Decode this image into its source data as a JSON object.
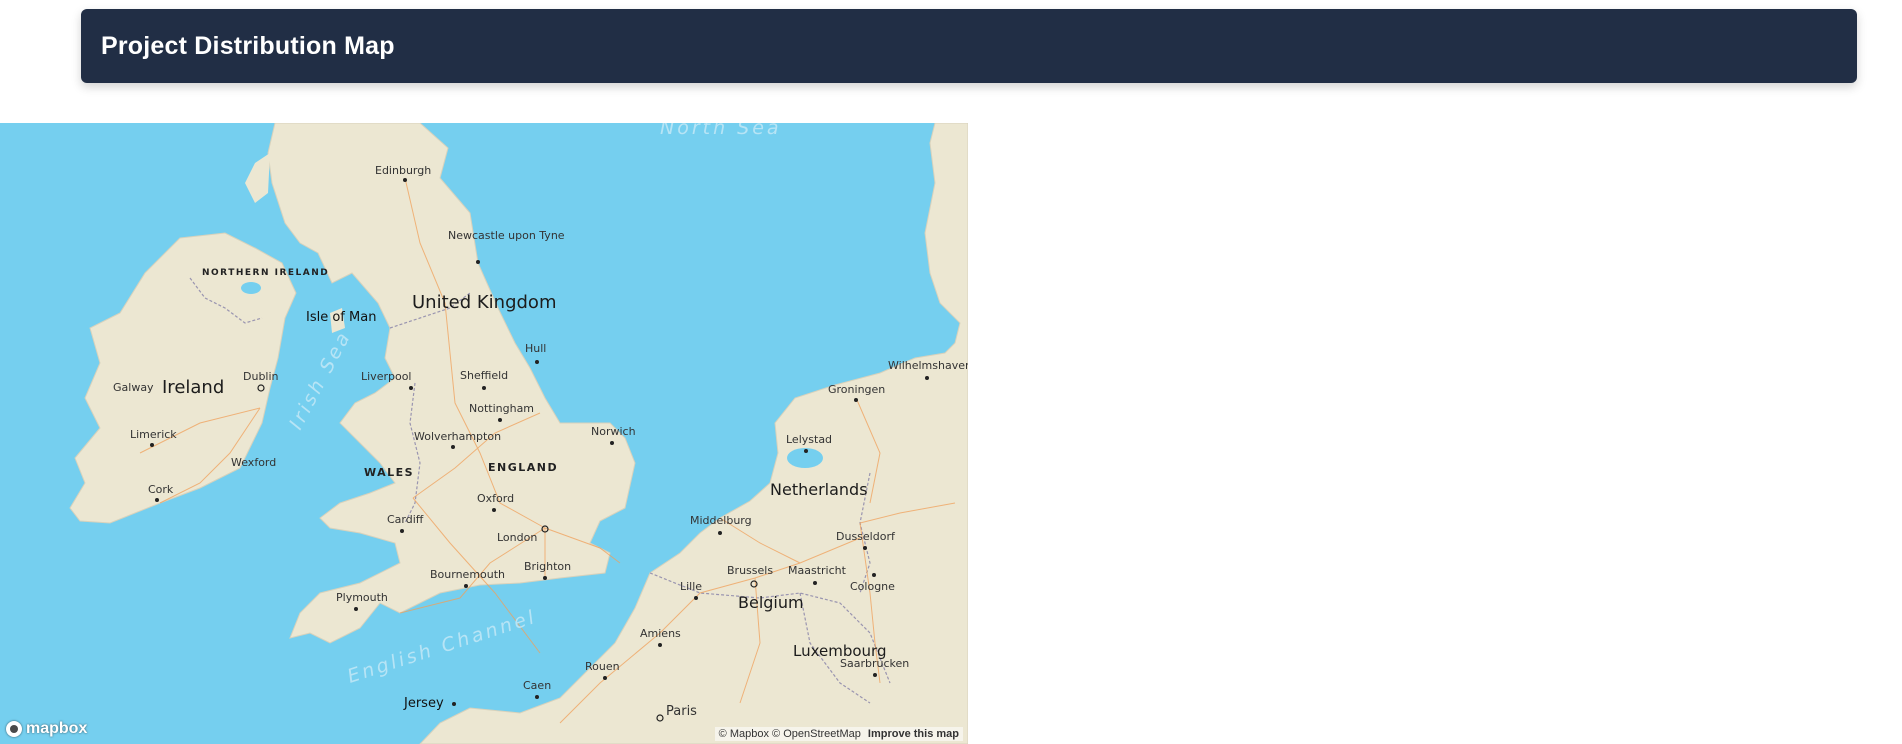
{
  "header": {
    "title": "Project Distribution Map"
  },
  "map": {
    "colors": {
      "water": "#75cfef",
      "land": "#ece7d2",
      "roads": "#f0a05a",
      "borders": "#9a95b0"
    },
    "seas": [
      "North Sea",
      "Irish Sea",
      "English Channel"
    ],
    "countries": [
      "United Kingdom",
      "Ireland",
      "Netherlands",
      "Belgium",
      "Luxembourg"
    ],
    "regions": [
      "NORTHERN IRELAND",
      "WALES",
      "ENGLAND"
    ],
    "places": [
      "Isle of Man",
      "Jersey"
    ],
    "cities": [
      "Edinburgh",
      "Newcastle upon Tyne",
      "Hull",
      "Liverpool",
      "Sheffield",
      "Nottingham",
      "Wolverhampton",
      "Norwich",
      "Oxford",
      "Cardiff",
      "London",
      "Bournemouth",
      "Brighton",
      "Plymouth",
      "Dublin",
      "Galway",
      "Limerick",
      "Wexford",
      "Cork",
      "Groningen",
      "Wilhelmshaven",
      "Lelystad",
      "Middelburg",
      "Dusseldorf",
      "Brussels",
      "Maastricht",
      "Cologne",
      "Lille",
      "Amiens",
      "Rouen",
      "Caen",
      "Paris",
      "Saarbrucken"
    ],
    "attribution": {
      "mapbox": "© Mapbox",
      "osm": "© OpenStreetMap",
      "improve": "Improve this map"
    },
    "logo": "mapbox"
  }
}
